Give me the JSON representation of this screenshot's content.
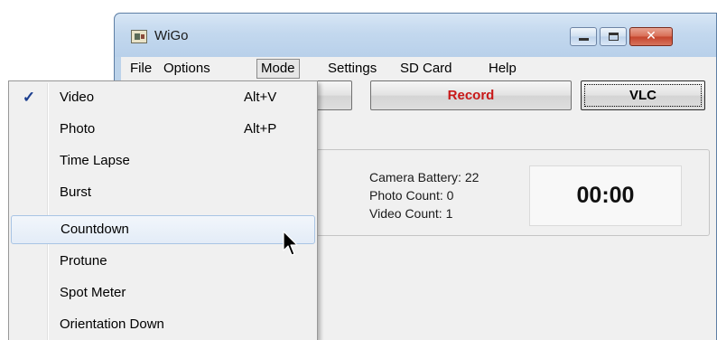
{
  "window": {
    "title": "WiGo",
    "close_glyph": "✕"
  },
  "menubar": {
    "file": "File",
    "options": "Options",
    "mode": "Mode",
    "settings": "Settings",
    "sd_card": "SD Card",
    "help": "Help"
  },
  "buttons": {
    "record": "Record",
    "vlc": "VLC"
  },
  "stats": {
    "battery": "Camera Battery: 22",
    "photo_count": "Photo Count: 0",
    "video_count": "Video Count: 1"
  },
  "timer": "00:00",
  "mode_menu": {
    "items": [
      {
        "label": "Video",
        "shortcut": "Alt+V",
        "checked": true,
        "check_glyph": "✓"
      },
      {
        "label": "Photo",
        "shortcut": "Alt+P"
      },
      {
        "label": "Time Lapse"
      },
      {
        "label": "Burst"
      },
      {
        "label": "Countdown",
        "hover": true
      },
      {
        "label": "Protune"
      },
      {
        "label": "Spot Meter"
      },
      {
        "label": "Orientation Down"
      }
    ]
  },
  "colors": {
    "record_text": "#c81818",
    "titlebar": "#c3d8ee",
    "close_button": "#c4442c",
    "checkmark": "#1c3f8f"
  },
  "icons": [
    "app-icon",
    "minimize-icon",
    "maximize-icon",
    "close-icon",
    "checkmark-icon",
    "mouse-cursor-icon"
  ]
}
